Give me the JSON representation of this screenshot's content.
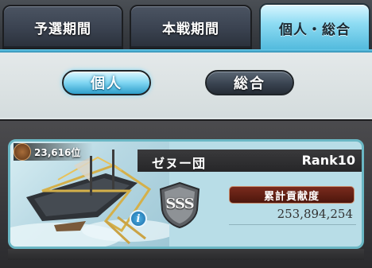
{
  "tabs": [
    {
      "label": "予選期間",
      "active": false
    },
    {
      "label": "本戦期間",
      "active": false
    },
    {
      "label": "個人・総合",
      "active": true
    }
  ],
  "modes": [
    {
      "label": "個人",
      "active": true
    },
    {
      "label": "総合",
      "active": false
    }
  ],
  "entry": {
    "rank_position": "23,616位",
    "crew_name": "ゼヌー団",
    "crew_rank": "Rank10",
    "grade": "SSS",
    "contribution_label": "累計貢献度",
    "contribution_value": "253,894,254",
    "info_icon": "i"
  },
  "colors": {
    "active_tab": "#8fdcf3",
    "inactive_tab": "#3a4250",
    "contribution_badge": "#7a2b1d"
  }
}
